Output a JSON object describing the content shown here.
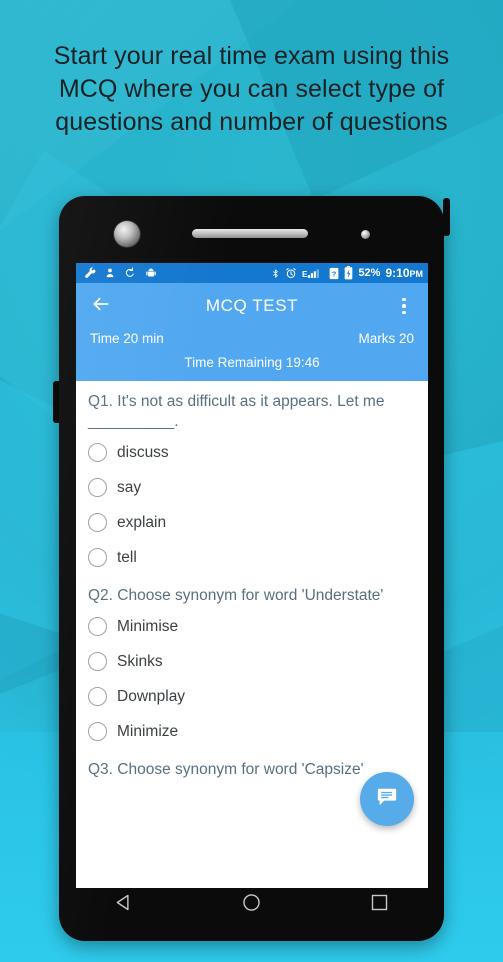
{
  "headline": {
    "line1": "Start your real time exam using this",
    "line2": "MCQ where you can select type of",
    "line3": "questions and number of questions"
  },
  "colors": {
    "background_teal": "#2CC7EA",
    "statusbar_blue": "#1478CE",
    "appbar_blue": "#51A8F0",
    "fab_blue": "#56ABE8",
    "question_text": "#58707E",
    "option_text": "#3A3F42",
    "headline_text": "#182226"
  },
  "status_bar": {
    "left_icons": [
      "wrench-icon",
      "person-icon",
      "screen-rotation-icon",
      "android-robot-icon"
    ],
    "right_icons": [
      "bluetooth-icon",
      "alarm-icon",
      "signal-edge-icon",
      "sim-card-icon",
      "battery-charging-icon"
    ],
    "battery_percent": "52%",
    "time": "9:10",
    "time_ampm": "PM"
  },
  "app_bar": {
    "back_icon": "arrow-left-icon",
    "title": "MCQ TEST",
    "overflow_icon": "more-vertical-icon",
    "time_limit": "Time 20 min",
    "marks": "Marks 20",
    "time_remaining": "Time Remaining 19:46"
  },
  "questions": [
    {
      "text": "Q1. It's not as difficult as it appears. Let me __________.",
      "options": [
        "discuss",
        "say",
        "explain",
        "tell"
      ]
    },
    {
      "text": "Q2. Choose synonym for word 'Understate'",
      "options": [
        "Minimise",
        "Skinks",
        "Downplay",
        "Minimize"
      ]
    },
    {
      "text": "Q3. Choose synonym for word 'Capsize'",
      "options": []
    }
  ],
  "fab": {
    "icon": "chat-bubble-icon"
  },
  "nav_bar": {
    "back": "triangle-back-icon",
    "home": "circle-home-icon",
    "recents": "square-recents-icon"
  }
}
